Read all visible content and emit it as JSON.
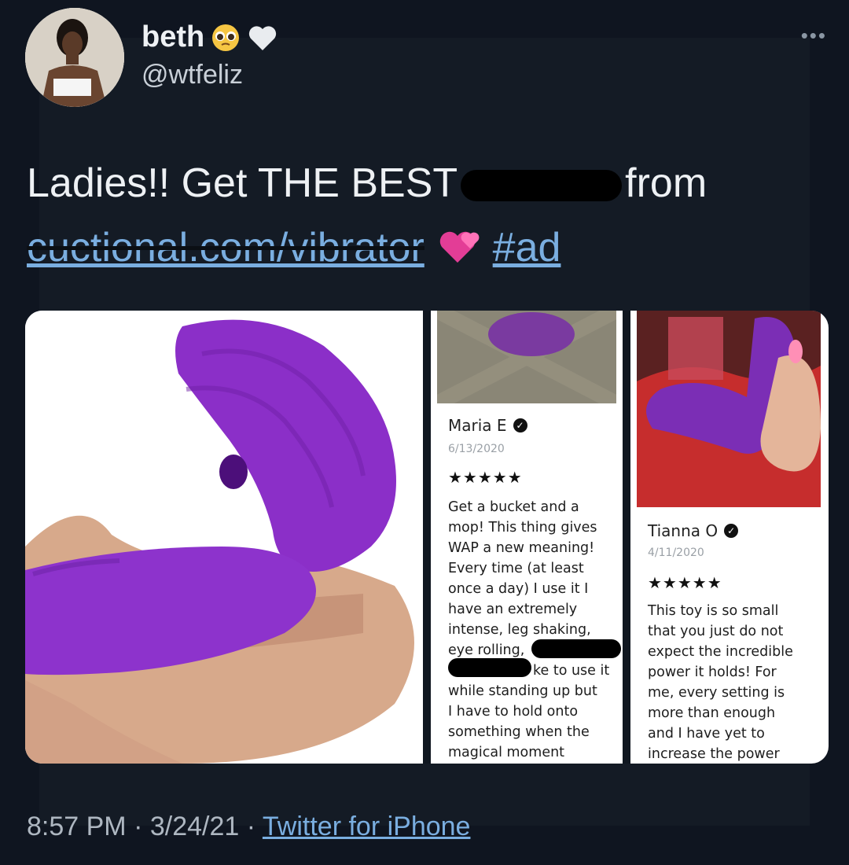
{
  "tweet": {
    "display_name": "beth",
    "handle": "@wtfeliz",
    "text_start": "Ladies!! Get THE BEST",
    "text_after_redaction": "from",
    "link_text": "cuctional.com/vibrator",
    "hashtag": "#ad",
    "timestamp": "8:57 PM · 3/24/21",
    "separator": "·",
    "source": "Twitter for iPhone"
  },
  "reviews": [
    {
      "name": "Maria E",
      "date": "6/13/2020",
      "stars": "★★★★★",
      "lines": [
        "Get a bucket and a",
        "mop! This thing gives",
        "WAP a new meaning!",
        "Every time (at least",
        "once a day) I use it I",
        "have an extremely",
        "intense, leg shaking,",
        "eye rolling,",
        "ke to use it",
        "while standing up but",
        "I have to hold onto",
        "something when the",
        "magical moment"
      ]
    },
    {
      "name": "Tianna O",
      "date": "4/11/2020",
      "stars": "★★★★★",
      "lines": [
        "This toy is so small",
        "that you just do not",
        "expect the incredible",
        "power it holds! For",
        "me, every setting is",
        "more than enough",
        "and I have yet to",
        "increase the power"
      ]
    }
  ],
  "icons": [
    "pleading-face-emoji",
    "white-heart-emoji",
    "more-options-icon",
    "two-hearts-emoji",
    "verified-check-icon"
  ],
  "colors": {
    "background": "#141b25",
    "link": "#7aaee0",
    "product_purple": "#8a2fc7"
  }
}
